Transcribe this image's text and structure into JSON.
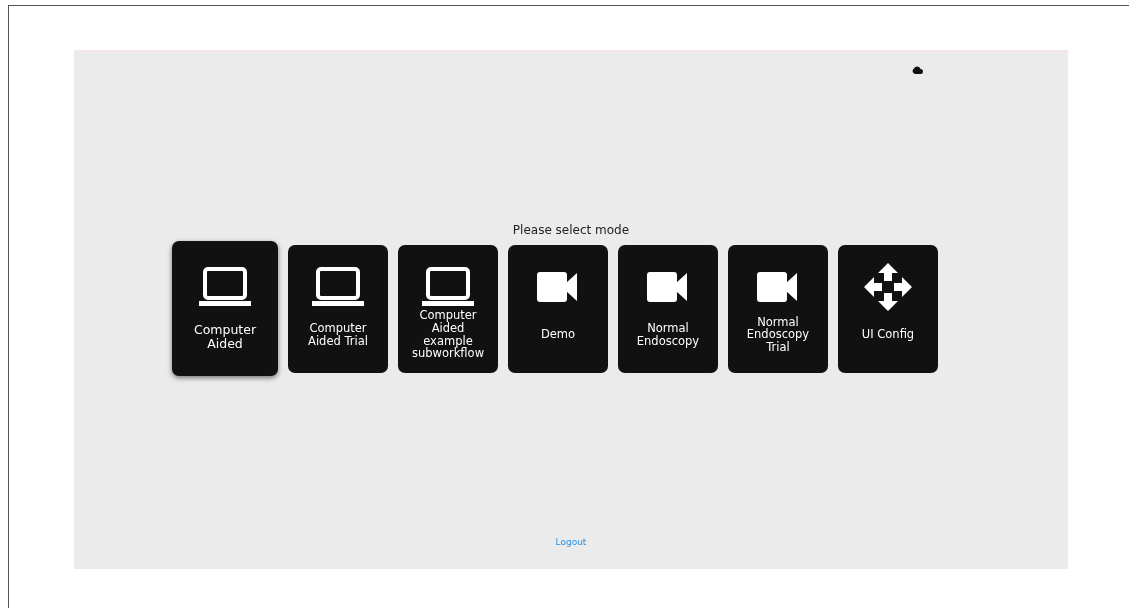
{
  "prompt": "Please select mode",
  "modes": [
    {
      "label": "Computer Aided",
      "kind": "laptop",
      "selected": true
    },
    {
      "label": "Computer Aided Trial",
      "kind": "laptop",
      "selected": false
    },
    {
      "label": "Computer Aided example subworkflow",
      "kind": "laptop",
      "selected": false
    },
    {
      "label": "Demo",
      "kind": "video",
      "selected": false
    },
    {
      "label": "Normal Endoscopy",
      "kind": "video",
      "selected": false
    },
    {
      "label": "Normal Endoscopy Trial",
      "kind": "video",
      "selected": false
    },
    {
      "label": "UI Config",
      "kind": "move",
      "selected": false
    }
  ],
  "logout": "Logout"
}
